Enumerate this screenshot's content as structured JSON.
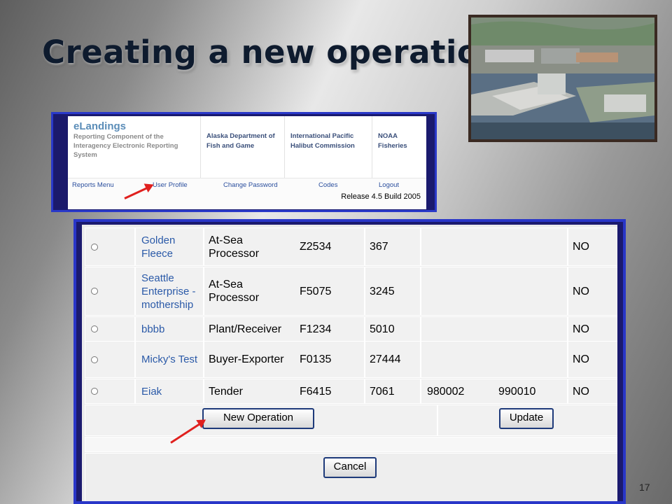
{
  "slide": {
    "title": "Creating a new operation",
    "page_number": "17"
  },
  "header_panel": {
    "brand_name": "eLandings",
    "brand_desc": "Reporting Component of the Interagency Electronic Reporting System",
    "agencies": [
      "Alaska Department of Fish and Game",
      "International Pacific Halibut Commission",
      "NOAA Fisheries"
    ],
    "nav": [
      "Reports Menu",
      "User Profile",
      "Change Password",
      "Codes",
      "Logout"
    ],
    "release": "Release 4.5 Build 2005"
  },
  "operations": {
    "rows": [
      {
        "name": "Golden Fleece",
        "type": "At-Sea Processor",
        "code": "Z2534",
        "num": "367",
        "c5": "",
        "c6": "",
        "flag": "NO"
      },
      {
        "name": "Seattle Enterprise - mothership",
        "type": "At-Sea Processor",
        "code": "F5075",
        "num": "3245",
        "c5": "",
        "c6": "",
        "flag": "NO"
      },
      {
        "name": "bbbb",
        "type": "Plant/Receiver",
        "code": "F1234",
        "num": "5010",
        "c5": "",
        "c6": "",
        "flag": "NO"
      },
      {
        "name": "Micky's Test",
        "type": "Buyer-Exporter",
        "code": "F0135",
        "num": "27444",
        "c5": "",
        "c6": "",
        "flag": "NO"
      },
      {
        "name": "Eiak",
        "type": "Tender",
        "code": "F6415",
        "num": "7061",
        "c5": "980002",
        "c6": "990010",
        "flag": "NO"
      }
    ],
    "new_operation_label": "New Operation",
    "update_label": "Update",
    "cancel_label": "Cancel"
  },
  "colors": {
    "title": "#0e1b2e",
    "frame_border": "#2936c8",
    "frame_fill": "#1b1a6e",
    "link": "#2b5aa8",
    "arrow": "#e0201e"
  }
}
